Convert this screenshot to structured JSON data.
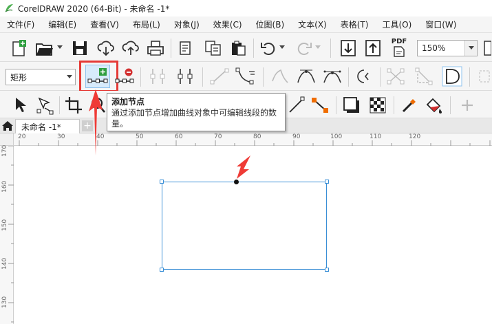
{
  "window": {
    "title": "CorelDRAW 2020 (64-Bit) - 未命名 -1*"
  },
  "menu": [
    {
      "label": "文件(F)"
    },
    {
      "label": "编辑(E)"
    },
    {
      "label": "查看(V)"
    },
    {
      "label": "布局(L)"
    },
    {
      "label": "对象(J)"
    },
    {
      "label": "效果(C)"
    },
    {
      "label": "位图(B)"
    },
    {
      "label": "文本(X)"
    },
    {
      "label": "表格(T)"
    },
    {
      "label": "工具(O)"
    },
    {
      "label": "窗口(W)"
    }
  ],
  "toolbar": {
    "zoom": "150%",
    "pdf_label": "PDF"
  },
  "property_bar": {
    "shape_type": "矩形"
  },
  "tooltip": {
    "title": "添加节点",
    "description": "通过添加节点增加曲线对象中可编辑线段的数量。"
  },
  "tabs": {
    "document": "未命名 -1*"
  },
  "ruler": {
    "horizontal": [
      "20",
      "30",
      "40",
      "50",
      "60",
      "70",
      "80",
      "90",
      "100",
      "110",
      "120"
    ],
    "vertical": [
      "170",
      "160",
      "150",
      "140",
      "130"
    ]
  },
  "colors": {
    "accent": "#3a8fd6",
    "highlight": "#e53935",
    "green": "#2e9e3f"
  }
}
